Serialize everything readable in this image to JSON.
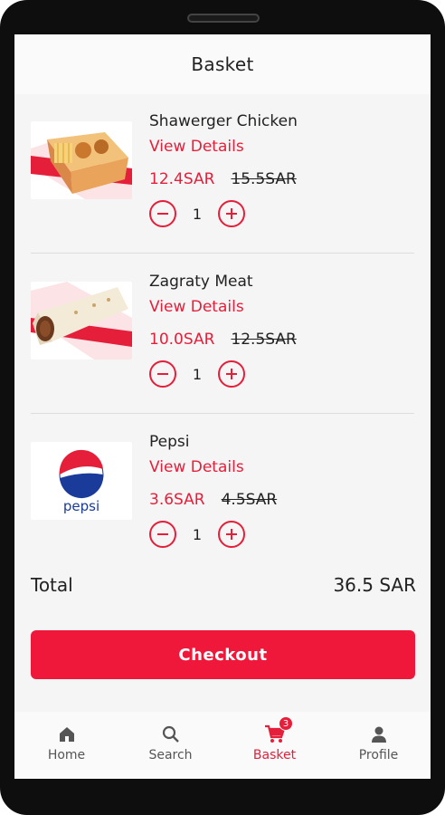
{
  "header": {
    "title": "Basket"
  },
  "items": [
    {
      "name": "Shawerger Chicken",
      "details_label": "View Details",
      "price": "12.4SAR",
      "old_price": "15.5SAR",
      "quantity": "1",
      "image_icon": "chicken-box-image"
    },
    {
      "name": "Zagraty Meat",
      "details_label": "View Details",
      "price": "10.0SAR",
      "old_price": "12.5SAR",
      "quantity": "1",
      "image_icon": "wrap-image"
    },
    {
      "name": "Pepsi",
      "details_label": "View Details",
      "price": "3.6SAR",
      "old_price": "4.5SAR",
      "quantity": "1",
      "image_icon": "pepsi-logo",
      "image_text": "pepsi"
    }
  ],
  "total": {
    "label": "Total",
    "value": "36.5 SAR"
  },
  "checkout_label": "Checkout",
  "nav": {
    "items": [
      {
        "label": "Home",
        "icon": "home-icon"
      },
      {
        "label": "Search",
        "icon": "search-icon"
      },
      {
        "label": "Basket",
        "icon": "cart-icon",
        "badge": "3",
        "active": true
      },
      {
        "label": "Profile",
        "icon": "profile-icon"
      }
    ]
  },
  "colors": {
    "accent": "#e51e3a",
    "checkout": "#f0183a"
  }
}
